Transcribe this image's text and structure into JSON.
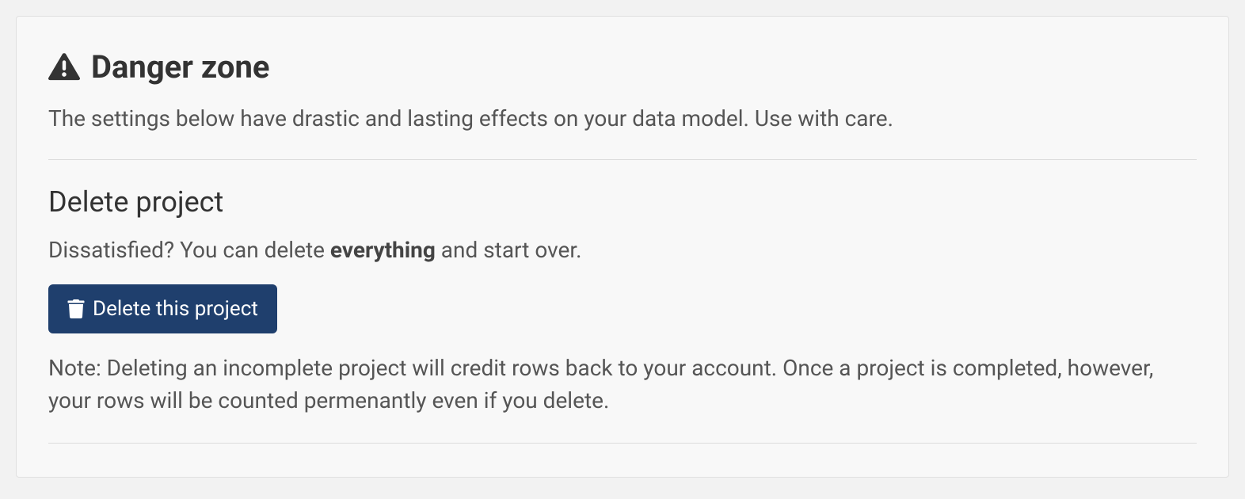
{
  "danger_zone": {
    "title": "Danger zone",
    "subtitle": "The settings below have drastic and lasting effects on your data model. Use with care.",
    "delete": {
      "heading": "Delete project",
      "description_prefix": "Dissatisfied? You can delete ",
      "description_bold": "everything",
      "description_suffix": " and start over.",
      "button_label": "Delete this project",
      "note": "Note: Deleting an incomplete project will credit rows back to your account. Once a project is completed, however, your rows will be counted permenantly even if you delete."
    }
  }
}
